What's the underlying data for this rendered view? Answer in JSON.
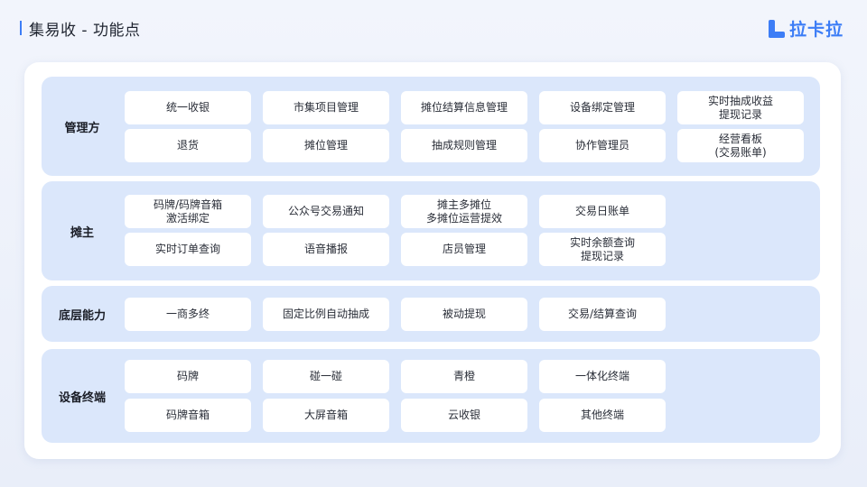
{
  "header": {
    "title": "集易收 - 功能点",
    "logo_text": "拉卡拉"
  },
  "colors": {
    "accent": "#3d7df6",
    "section_bg": "#dbe7fb",
    "card_bg": "#ffffff"
  },
  "sections": [
    {
      "label": "管理方",
      "rows": [
        [
          "统一收银",
          "市集项目管理",
          "摊位结算信息管理",
          "设备绑定管理",
          "实时抽成收益\n提现记录"
        ],
        [
          "退货",
          "摊位管理",
          "抽成规则管理",
          "协作管理员",
          "经营看板\n(交易账单)"
        ]
      ]
    },
    {
      "label": "摊主",
      "rows": [
        [
          "码牌/码牌音箱\n激活绑定",
          "公众号交易通知",
          "摊主多摊位\n多摊位运营提效",
          "交易日账单"
        ],
        [
          "实时订单查询",
          "语音播报",
          "店员管理",
          "实时余额查询\n提现记录"
        ]
      ]
    },
    {
      "label": "底层能力",
      "rows": [
        [
          "一商多终",
          "固定比例自动抽成",
          "被动提现",
          "交易/结算查询"
        ]
      ]
    },
    {
      "label": "设备终端",
      "rows": [
        [
          "码牌",
          "碰一碰",
          "青橙",
          "一体化终端"
        ],
        [
          "码牌音箱",
          "大屏音箱",
          "云收银",
          "其他终端"
        ]
      ]
    }
  ]
}
